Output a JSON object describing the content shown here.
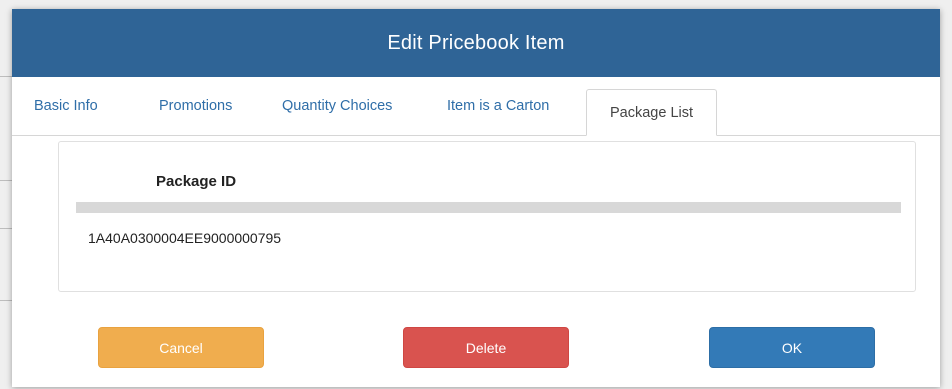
{
  "dialog": {
    "title": "Edit Pricebook Item"
  },
  "tabs": [
    {
      "label": "Basic Info",
      "active": false
    },
    {
      "label": "Promotions",
      "active": false
    },
    {
      "label": "Quantity Choices",
      "active": false
    },
    {
      "label": "Item is a Carton",
      "active": false
    },
    {
      "label": "Package List",
      "active": true
    }
  ],
  "package_list": {
    "column_header": "Package ID",
    "rows": [
      "1A40A0300004EE9000000795"
    ]
  },
  "buttons": {
    "cancel": "Cancel",
    "delete": "Delete",
    "ok": "OK"
  },
  "colors": {
    "header": "#2f6496",
    "tab_link": "#2f6ea8",
    "cancel": "#f0ad4e",
    "delete": "#d9534f",
    "ok": "#337ab7"
  }
}
